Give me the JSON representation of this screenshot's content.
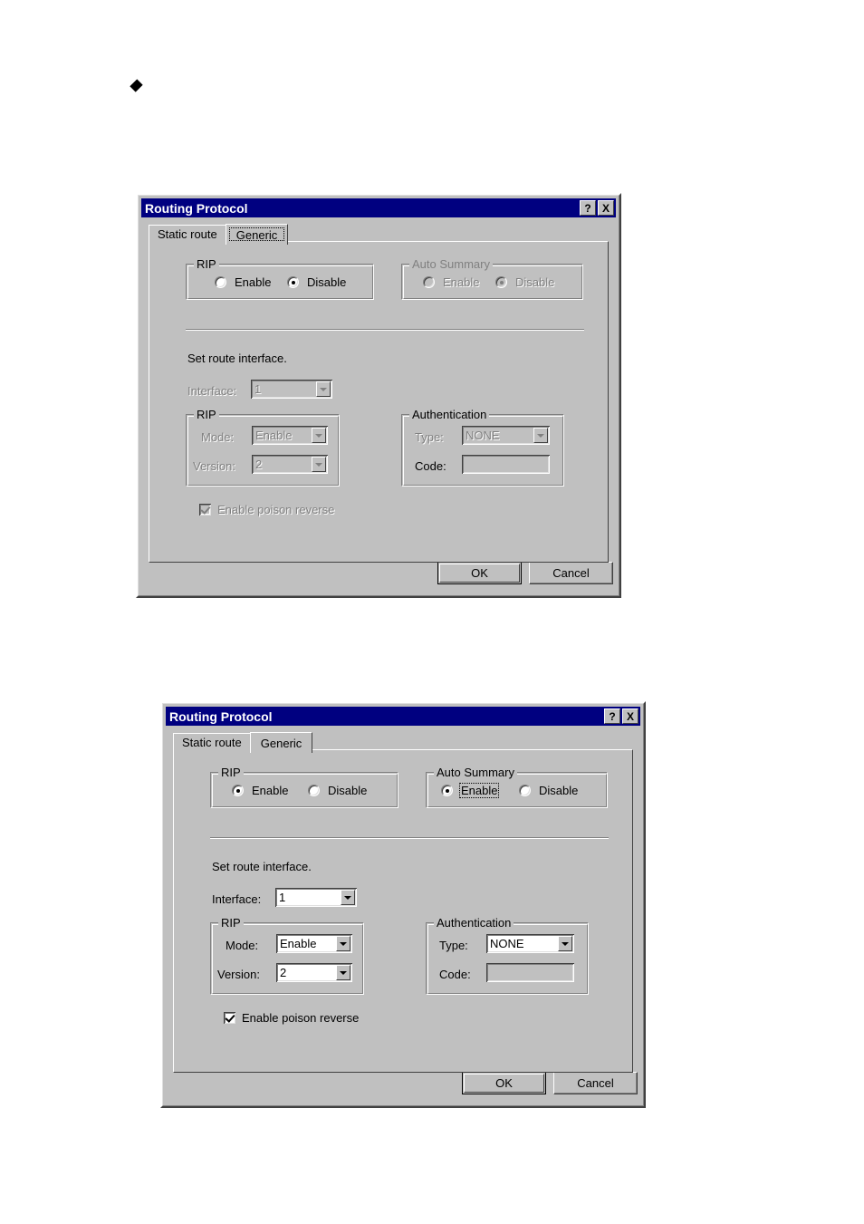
{
  "page": {
    "bullet_glyph": "diamond-bullet"
  },
  "dialogs": [
    {
      "id": "routing-protocol-disabled",
      "title": "Routing Protocol",
      "titlebar_buttons": [
        {
          "name": "help-button",
          "label": "?"
        },
        {
          "name": "close-button",
          "label": "X"
        }
      ],
      "tabs": [
        {
          "label": "Static route",
          "active": false,
          "focused": false
        },
        {
          "label": "Generic",
          "active": true,
          "focused": true
        }
      ],
      "rip_group": {
        "title": "RIP",
        "options": [
          {
            "label": "Enable",
            "checked": false,
            "disabled": false,
            "focused": false
          },
          {
            "label": "Disable",
            "checked": true,
            "disabled": false,
            "focused": false
          }
        ]
      },
      "auto_summary_group": {
        "title": "Auto Summary",
        "options": [
          {
            "label": "Enable",
            "checked": false,
            "disabled": true,
            "focused": false
          },
          {
            "label": "Disable",
            "checked": true,
            "disabled": true,
            "focused": false
          }
        ]
      },
      "instruction": "Set route interface.",
      "interface": {
        "label": "Interface:",
        "value": "1",
        "disabled": true
      },
      "rip_iface_group": {
        "title": "RIP",
        "mode": {
          "label": "Mode:",
          "value": "Enable",
          "disabled": true
        },
        "version": {
          "label": "Version:",
          "value": "2",
          "disabled": true
        }
      },
      "authentication_group": {
        "title": "Authentication",
        "type": {
          "label": "Type:",
          "value": "NONE",
          "disabled": true
        },
        "code": {
          "label": "Code:",
          "value": "",
          "disabled": true
        }
      },
      "poison_reverse": {
        "label": "Enable poison reverse",
        "checked": true,
        "disabled": true
      },
      "buttons": {
        "ok": "OK",
        "cancel": "Cancel"
      }
    },
    {
      "id": "routing-protocol-enabled",
      "title": "Routing Protocol",
      "titlebar_buttons": [
        {
          "name": "help-button",
          "label": "?"
        },
        {
          "name": "close-button",
          "label": "X"
        }
      ],
      "tabs": [
        {
          "label": "Static route",
          "active": false,
          "focused": false
        },
        {
          "label": "Generic",
          "active": true,
          "focused": false
        }
      ],
      "rip_group": {
        "title": "RIP",
        "options": [
          {
            "label": "Enable",
            "checked": true,
            "disabled": false,
            "focused": false
          },
          {
            "label": "Disable",
            "checked": false,
            "disabled": false,
            "focused": false
          }
        ]
      },
      "auto_summary_group": {
        "title": "Auto Summary",
        "options": [
          {
            "label": "Enable",
            "checked": true,
            "disabled": false,
            "focused": true
          },
          {
            "label": "Disable",
            "checked": false,
            "disabled": false,
            "focused": false
          }
        ]
      },
      "instruction": "Set route interface.",
      "interface": {
        "label": "Interface:",
        "value": "1",
        "disabled": false
      },
      "rip_iface_group": {
        "title": "RIP",
        "mode": {
          "label": "Mode:",
          "value": "Enable",
          "disabled": false
        },
        "version": {
          "label": "Version:",
          "value": "2",
          "disabled": false
        }
      },
      "authentication_group": {
        "title": "Authentication",
        "type": {
          "label": "Type:",
          "value": "NONE",
          "disabled": false
        },
        "code": {
          "label": "Code:",
          "value": "",
          "disabled": true
        }
      },
      "poison_reverse": {
        "label": "Enable poison reverse",
        "checked": true,
        "disabled": false
      },
      "buttons": {
        "ok": "OK",
        "cancel": "Cancel"
      }
    }
  ],
  "colors": {
    "titlebar": "#000080",
    "face": "#c0c0c0",
    "shadow": "#808080",
    "dark": "#404040",
    "light": "#ffffff",
    "text": "#000000",
    "disabled_text": "#808080"
  }
}
